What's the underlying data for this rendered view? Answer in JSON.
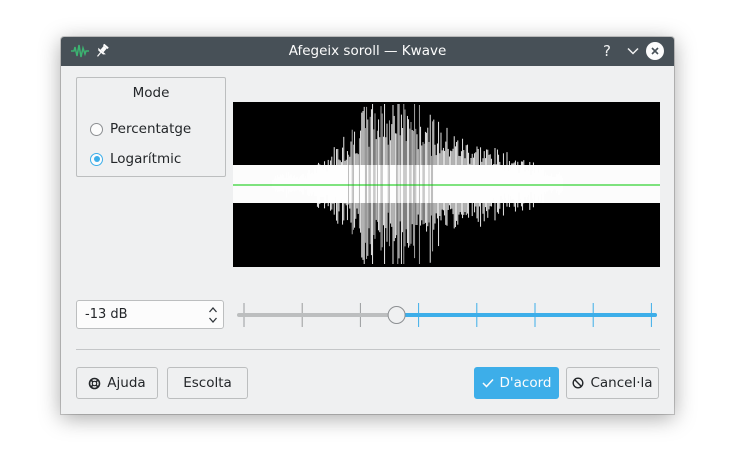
{
  "window": {
    "title": "Afegeix soroll — Kwave",
    "help_glyph": "?",
    "icons": {
      "app": "waveform-icon",
      "pin": "pin-icon",
      "minimize": "chevron-down-icon",
      "close": "close-icon"
    }
  },
  "mode": {
    "title": "Mode",
    "options": [
      {
        "label": "Percentatge",
        "selected": false
      },
      {
        "label": "Logarítmic",
        "selected": true
      }
    ]
  },
  "level": {
    "spin_value": "-13 dB",
    "slider_fraction": 0.38
  },
  "buttons": {
    "help": "Ajuda",
    "listen": "Escolta",
    "ok": "D'acord",
    "cancel": "Cancel·la"
  },
  "colors": {
    "titlebar": "#475057",
    "accent": "#3daee9",
    "background": "#eff0f1",
    "waveform": "#ffffff",
    "waveform_noise": "#b4b4b4",
    "zero_line": "#00c800",
    "app_icon": "#3cb371"
  }
}
